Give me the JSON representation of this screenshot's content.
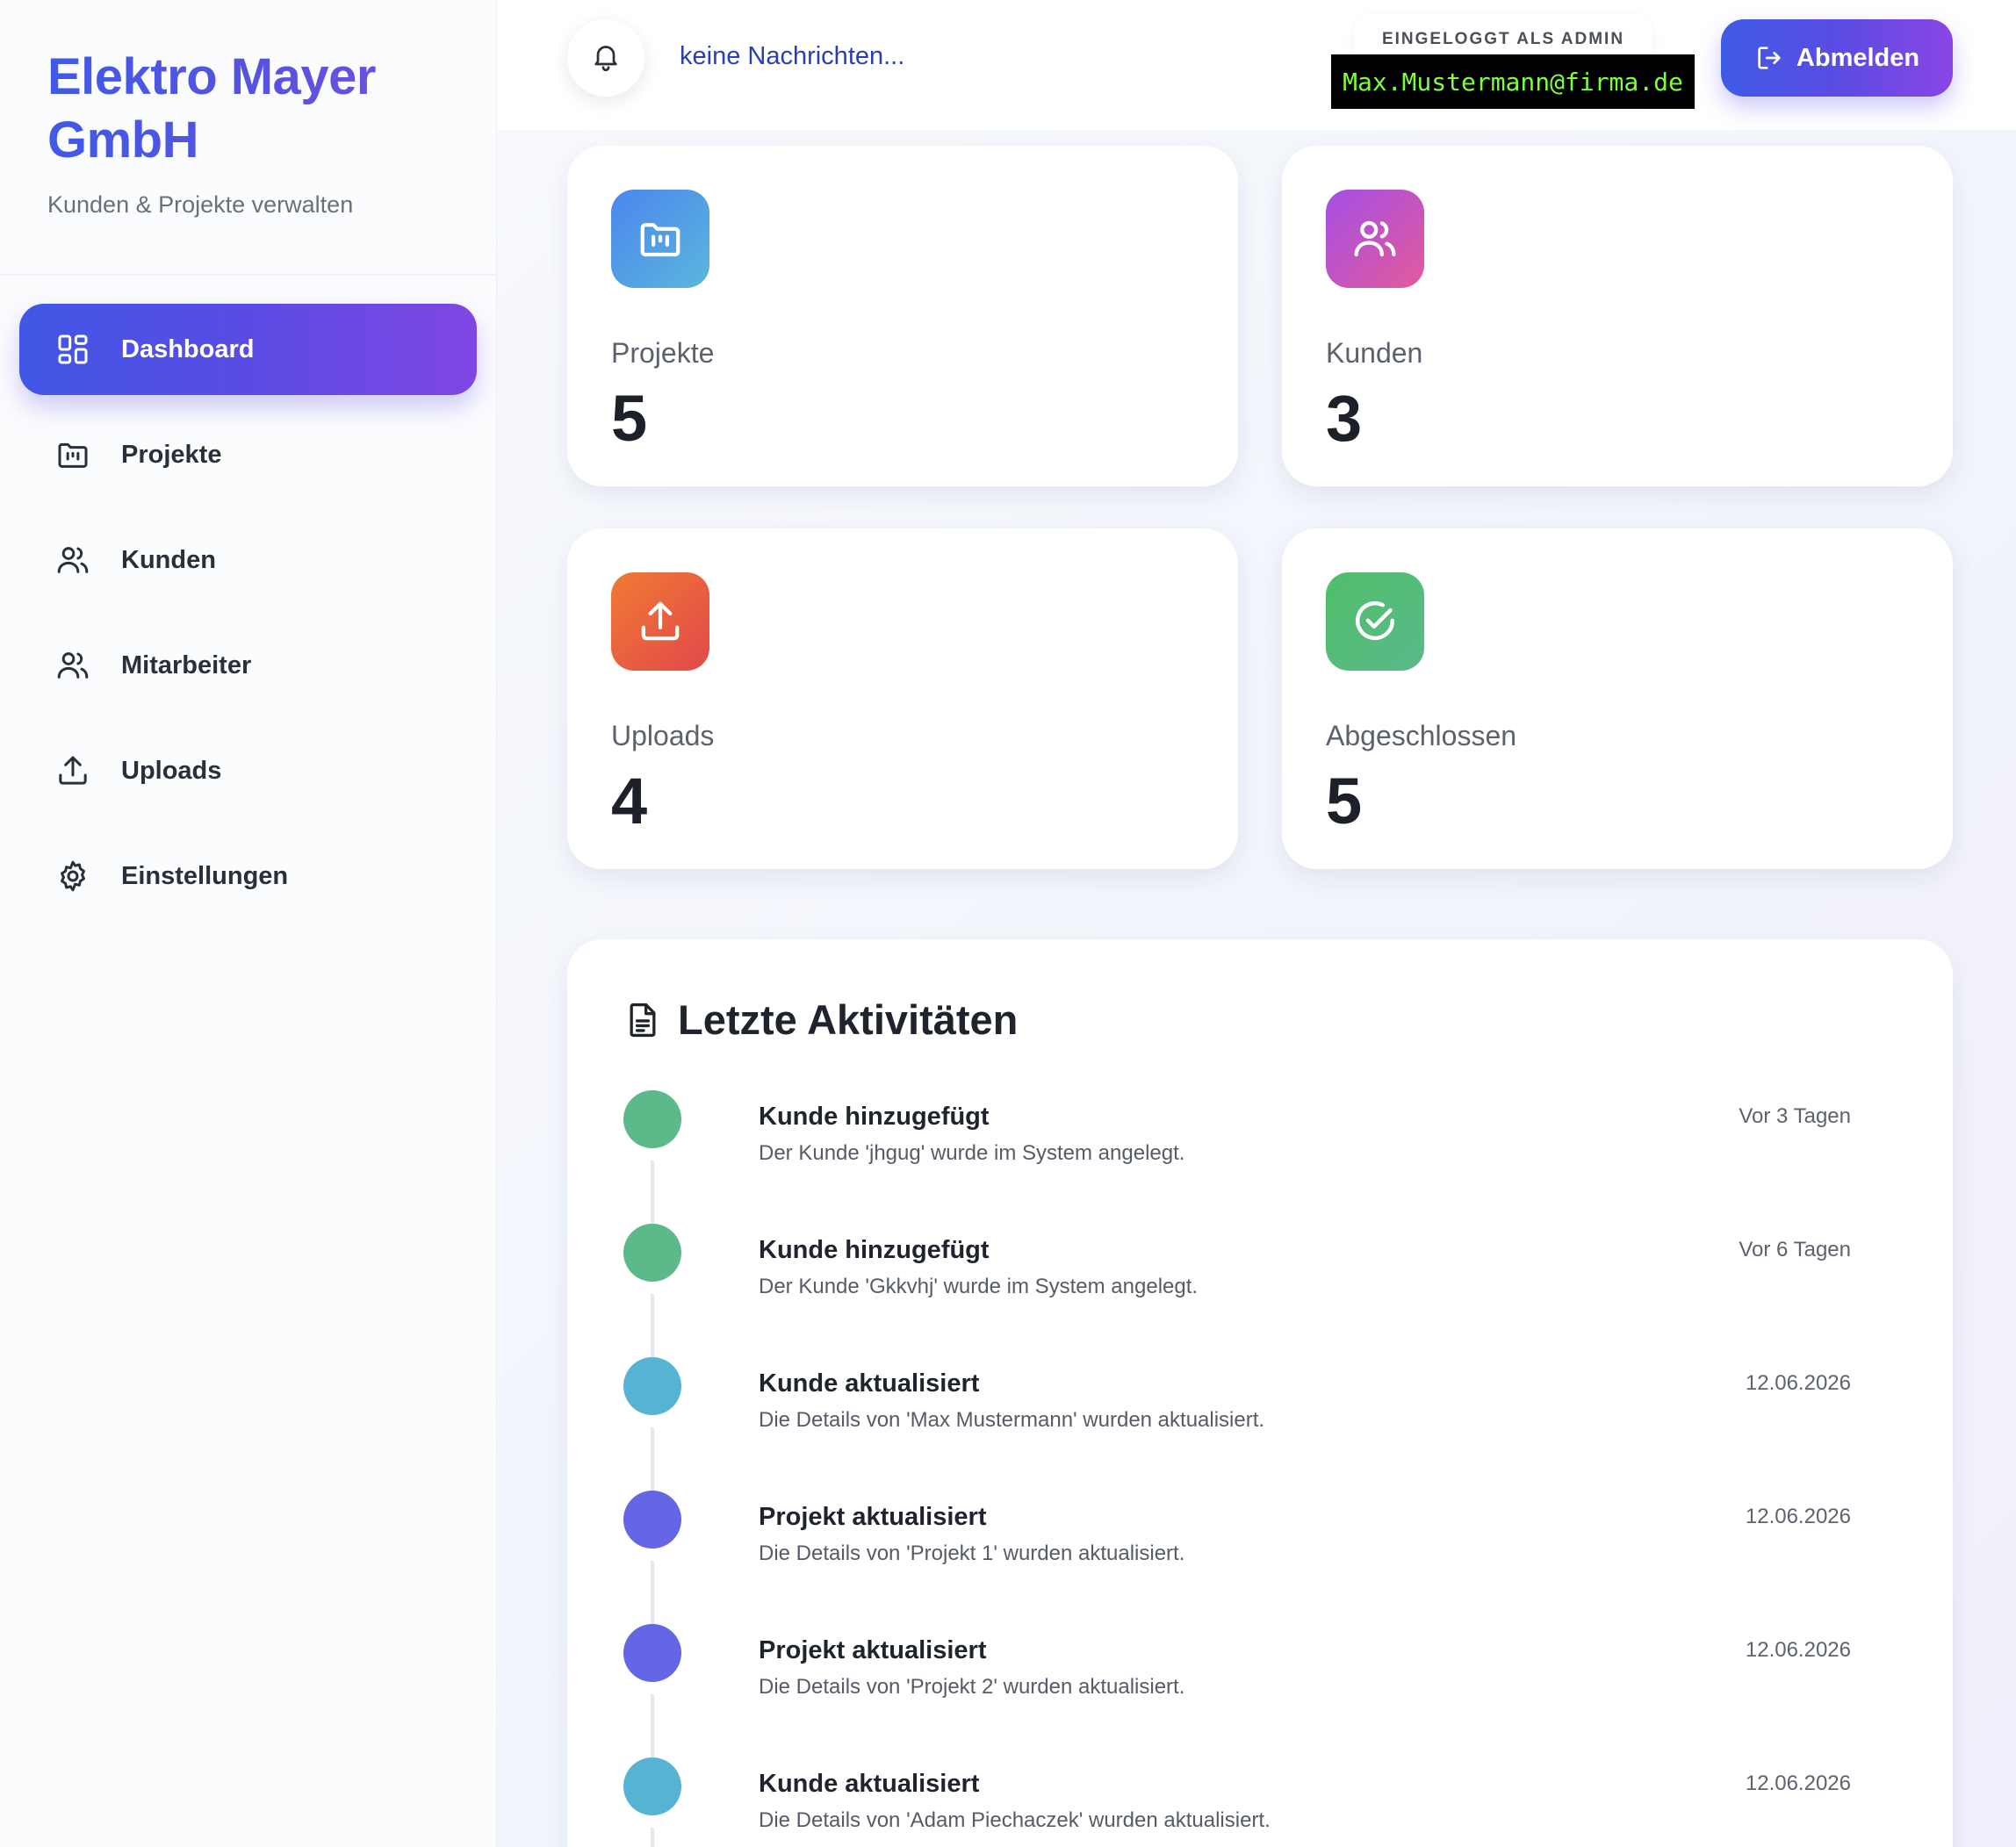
{
  "brand": {
    "title_line1": "Elektro Mayer",
    "title_line2": "GmbH",
    "subtitle": "Kunden & Projekte verwalten"
  },
  "nav": {
    "items": [
      {
        "label": "Dashboard",
        "icon": "dashboard-grid-icon",
        "active": true
      },
      {
        "label": "Projekte",
        "icon": "folder-icon"
      },
      {
        "label": "Kunden",
        "icon": "users-icon"
      },
      {
        "label": "Mitarbeiter",
        "icon": "users-icon"
      },
      {
        "label": "Uploads",
        "icon": "upload-icon"
      },
      {
        "label": "Einstellungen",
        "icon": "gear-icon"
      }
    ]
  },
  "header": {
    "notification_text": "keine Nachrichten...",
    "login_label": "EINGELOGGT ALS ADMIN",
    "login_email": "Max.Mustermann@firma.de",
    "logout_label": "Abmelden"
  },
  "stats": [
    {
      "label": "Projekte",
      "value": "5",
      "icon": "folder-icon",
      "color_from": "#4a86ee",
      "color_to": "#5bb6dc"
    },
    {
      "label": "Kunden",
      "value": "3",
      "icon": "users-icon",
      "color_from": "#a34fe6",
      "color_to": "#e45a9a"
    },
    {
      "label": "Uploads",
      "value": "4",
      "icon": "upload-icon",
      "color_from": "#ef7a35",
      "color_to": "#e3484a"
    },
    {
      "label": "Abgeschlossen",
      "value": "5",
      "icon": "check-circle-icon",
      "color_from": "#4fbf6a",
      "color_to": "#5ab98a"
    }
  ],
  "activity": {
    "title": "Letzte Aktivitäten",
    "items": [
      {
        "title": "Kunde hinzugefügt",
        "desc": "Der Kunde 'jhgug' wurde im System angelegt.",
        "time": "Vor 3 Tagen",
        "color": "#5bb98a"
      },
      {
        "title": "Kunde hinzugefügt",
        "desc": "Der Kunde 'Gkkvhj' wurde im System angelegt.",
        "time": "Vor 6 Tagen",
        "color": "#5bb98a"
      },
      {
        "title": "Kunde aktualisiert",
        "desc": "Die Details von 'Max Mustermann' wurden aktualisiert.",
        "time": "12.06.2026",
        "color": "#56b3d3"
      },
      {
        "title": "Projekt aktualisiert",
        "desc": "Die Details von 'Projekt 1' wurden aktualisiert.",
        "time": "12.06.2026",
        "color": "#6466e6"
      },
      {
        "title": "Projekt aktualisiert",
        "desc": "Die Details von 'Projekt 2' wurden aktualisiert.",
        "time": "12.06.2026",
        "color": "#6466e6"
      },
      {
        "title": "Kunde aktualisiert",
        "desc": "Die Details von 'Adam Piechaczek' wurden aktualisiert.",
        "time": "12.06.2026",
        "color": "#56b3d3"
      }
    ]
  }
}
